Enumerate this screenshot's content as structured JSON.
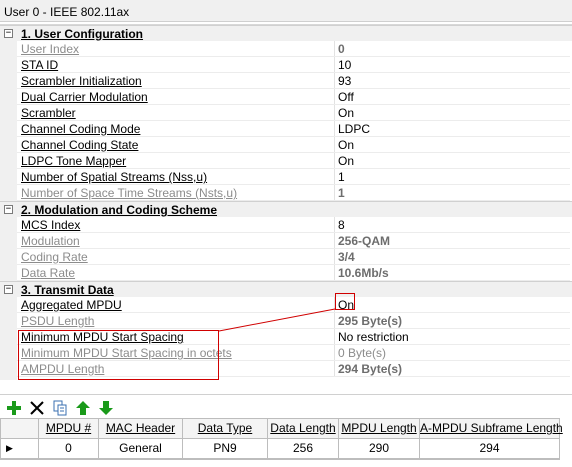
{
  "window": {
    "title": "User 0 - IEEE 802.11ax"
  },
  "sections": [
    {
      "title": "1. User Configuration",
      "toggle": "−",
      "rows": [
        {
          "name": "User Index",
          "value": "0",
          "disabled": true,
          "bold": true
        },
        {
          "name": "STA ID",
          "value": "10"
        },
        {
          "name": "Scrambler Initialization",
          "value": "93"
        },
        {
          "name": "Dual Carrier Modulation",
          "value": "Off"
        },
        {
          "name": "Scrambler",
          "value": "On"
        },
        {
          "name": "Channel Coding Mode",
          "value": "LDPC"
        },
        {
          "name": "Channel Coding State",
          "value": "On"
        },
        {
          "name": "LDPC Tone Mapper",
          "value": "On"
        },
        {
          "name": "Number of Spatial Streams (Nss,u)",
          "value": "1"
        },
        {
          "name": "Number of Space Time Streams (Nsts,u)",
          "value": "1",
          "disabled": true,
          "bold": true
        }
      ]
    },
    {
      "title": "2. Modulation and Coding Scheme",
      "toggle": "−",
      "rows": [
        {
          "name": "MCS Index",
          "value": "8"
        },
        {
          "name": "Modulation",
          "value": "256-QAM",
          "disabled": true,
          "bold": true
        },
        {
          "name": "Coding Rate",
          "value": "3/4",
          "disabled": true,
          "bold": true
        },
        {
          "name": "Data Rate",
          "value": "10.6Mb/s",
          "disabled": true,
          "bold": true
        }
      ]
    },
    {
      "title": "3. Transmit Data",
      "toggle": "−",
      "rows": [
        {
          "name": "Aggregated MPDU",
          "value": "On"
        },
        {
          "name": "PSDU Length",
          "value": "295 Byte(s)",
          "disabled": true,
          "bold": true
        },
        {
          "name": "Minimum MPDU Start Spacing",
          "value": "No restriction"
        },
        {
          "name": "Minimum MPDU Start Spacing in octets",
          "value": "0 Byte(s)",
          "disabled": true
        },
        {
          "name": "AMPDU Length",
          "value": "294 Byte(s)",
          "disabled": true,
          "bold": true
        }
      ]
    }
  ],
  "toolbar": [
    {
      "icon": "add-icon",
      "color": "#1a9a1a"
    },
    {
      "icon": "delete-icon",
      "color": "#000000"
    },
    {
      "icon": "copy-icon",
      "color": "#3a6fb0"
    },
    {
      "icon": "move-up-icon",
      "color": "#1a9a1a"
    },
    {
      "icon": "move-down-icon",
      "color": "#1a9a1a"
    }
  ],
  "table": {
    "columns": [
      "MPDU #",
      "MAC Header",
      "Data Type",
      "Data Length",
      "MPDU Length",
      "A-MPDU Subframe Length"
    ],
    "rows": [
      [
        "0",
        "General",
        "PN9",
        "256",
        "290",
        "294"
      ]
    ],
    "row_marker": "▶"
  },
  "colors": {
    "highlight": "#d00000",
    "disabled_text": "#8c8c8c",
    "category_bg": "#f0f0f0"
  }
}
